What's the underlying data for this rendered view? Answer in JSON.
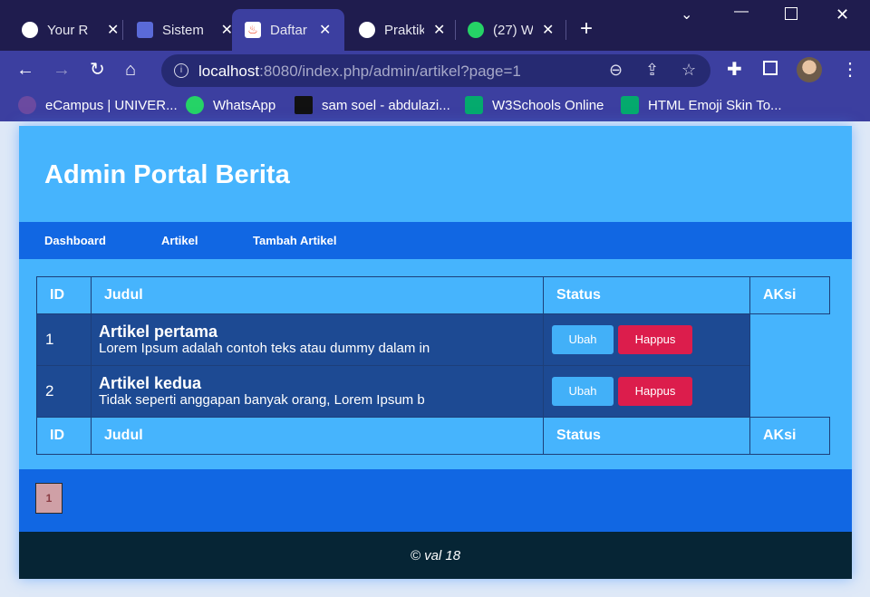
{
  "browser": {
    "tabs": [
      {
        "label": "Your R",
        "icon": "github-icon",
        "color": "#ffffff"
      },
      {
        "label": "Sistem",
        "icon": "logo-icon",
        "color": "#5a6ad8"
      },
      {
        "label": "Daftar",
        "icon": "codeigniter-icon",
        "color": "#ee4323"
      },
      {
        "label": "Praktik",
        "icon": "globe-icon",
        "color": "#ffffff"
      },
      {
        "label": "(27) W",
        "icon": "whatsapp-icon",
        "color": "#25d366"
      }
    ],
    "url_host": "localhost",
    "url_rest": ":8080/index.php/admin/artikel?page=1",
    "bookmarks": [
      {
        "label": "eCampus | UNIVER...",
        "icon": "ecampus-icon",
        "color": "#6b4aa0"
      },
      {
        "label": "WhatsApp",
        "icon": "whatsapp-icon",
        "color": "#25d366"
      },
      {
        "label": "sam soel - abdulazi...",
        "icon": "hackerrank-icon",
        "color": "#111111"
      },
      {
        "label": "W3Schools Online",
        "icon": "w3schools-icon",
        "color": "#04aa6d"
      },
      {
        "label": "HTML Emoji Skin To...",
        "icon": "w3schools-icon",
        "color": "#04aa6d"
      }
    ]
  },
  "header": {
    "title": "Admin Portal Berita"
  },
  "nav": {
    "items": [
      "Dashboard",
      "Artikel",
      "Tambah Artikel"
    ]
  },
  "table": {
    "headers": [
      "ID",
      "Judul",
      "Status",
      "AKsi"
    ],
    "rows": [
      {
        "id": "1",
        "title": "Artikel pertama",
        "desc": "Lorem Ipsum adalah contoh teks atau dummy dalam in",
        "edit": "Ubah",
        "delete": "Happus"
      },
      {
        "id": "2",
        "title": "Artikel kedua",
        "desc": "Tidak seperti anggapan banyak orang, Lorem Ipsum b",
        "edit": "Ubah",
        "delete": "Happus"
      }
    ]
  },
  "pager": {
    "current": "1"
  },
  "footer": {
    "text": "© val 18"
  },
  "colors": {
    "header_bg": "#46b4fd",
    "nav_bg": "#1167e3",
    "row_bg": "#1d4a93",
    "edit_btn": "#42b0f8",
    "delete_btn": "#dc1d4c",
    "footer_bg": "#062535"
  }
}
